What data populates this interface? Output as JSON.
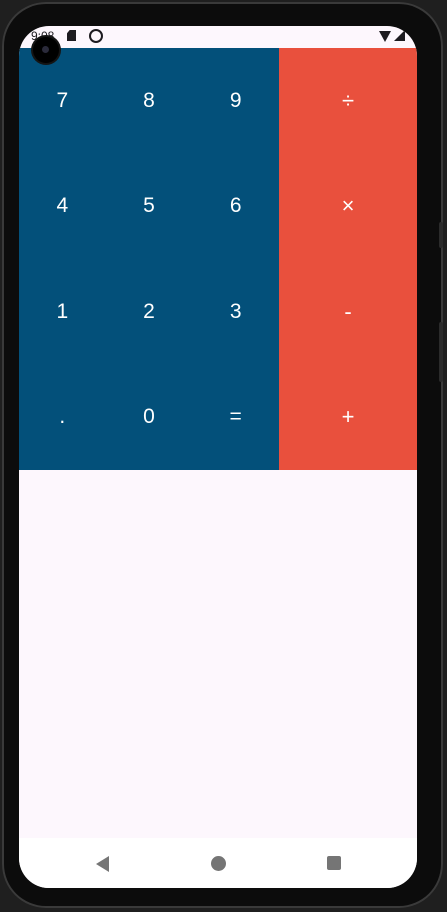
{
  "status_bar": {
    "time": "9:08",
    "icons": [
      "sd-card-icon",
      "sync-icon",
      "wifi-icon",
      "signal-icon",
      "battery-icon"
    ]
  },
  "keypad": {
    "number_keys": [
      "7",
      "8",
      "9",
      "4",
      "5",
      "6",
      "1",
      "2",
      "3",
      ".",
      "0",
      "="
    ],
    "operator_keys": [
      "÷",
      "×",
      "-",
      "+"
    ]
  },
  "navigation": {
    "icons": [
      "back-icon",
      "home-icon",
      "recents-icon"
    ]
  },
  "colors": {
    "number_pad": "#03507a",
    "operator_pad": "#e9503d",
    "background": "#fdf7fd",
    "key_text": "#ffffff"
  }
}
